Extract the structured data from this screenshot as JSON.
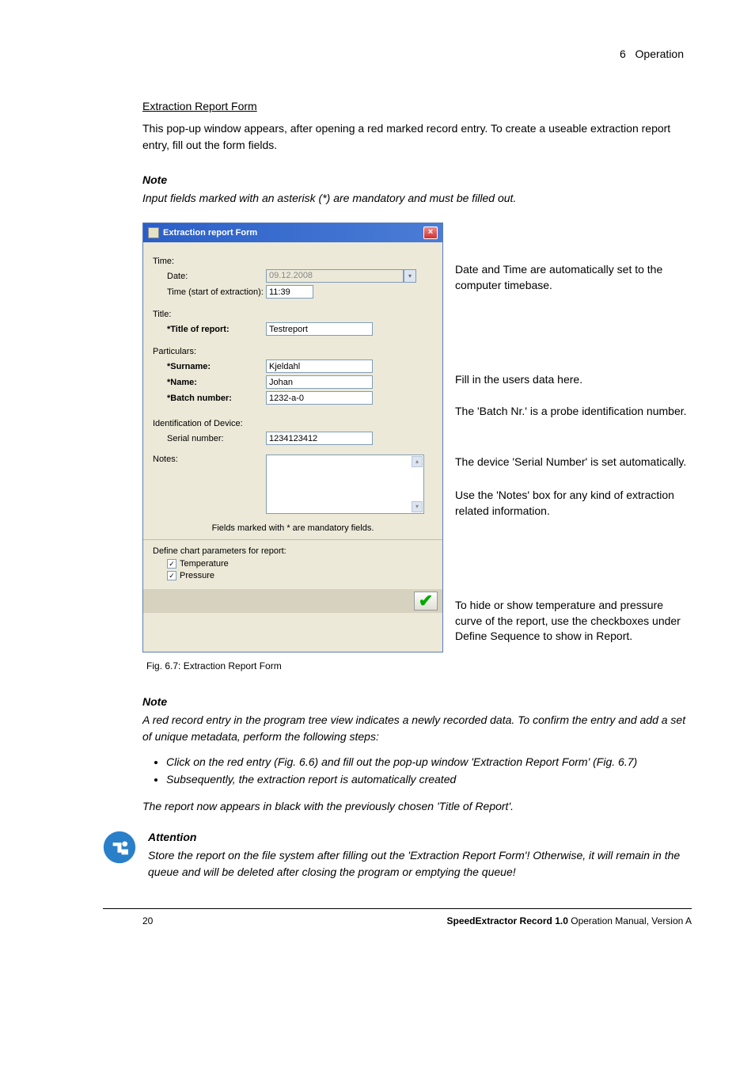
{
  "header": {
    "section_num": "6",
    "section_title": "Operation"
  },
  "section_heading": "Extraction Report Form",
  "intro_text": "This pop-up window appears, after opening a red marked record entry. To create a useable extraction report entry, fill out the form fields.",
  "note1": {
    "heading": "Note",
    "text": "Input fields marked with an asterisk (*) are mandatory and must be filled out."
  },
  "dialog": {
    "title": "Extraction report Form",
    "close": "×",
    "groups": {
      "time": "Time:",
      "title": "Title:",
      "particulars": "Particulars:",
      "identification": "Identification of Device:",
      "notes": "Notes:",
      "define_params": "Define chart parameters for report:"
    },
    "labels": {
      "date": "Date:",
      "time_start": "Time (start of extraction):",
      "title_report": "*Title of report:",
      "surname": "*Surname:",
      "name": "*Name:",
      "batch": "*Batch number:",
      "serial": "Serial number:",
      "temperature": "Temperature",
      "pressure": "Pressure"
    },
    "values": {
      "date": "09.12.2008",
      "time": "11:39",
      "title_report": "Testreport",
      "surname": "Kjeldahl",
      "name": "Johan",
      "batch": "1232-a-0",
      "serial": "1234123412"
    },
    "mandatory_hint": "Fields marked with * are mandatory fields.",
    "temperature_checked": true,
    "pressure_checked": true
  },
  "annotations": {
    "datetime": "Date and Time are automatically set to the computer timebase.",
    "users": "Fill in the users data here.",
    "batch": "The 'Batch Nr.' is a probe identification number.",
    "serial": "The device 'Serial Number' is set automatically.",
    "notes": "Use the 'Notes' box for any kind of extraction related information.",
    "checkboxes": "To hide or show temperature and pressure curve of the report, use the checkboxes under Define Sequence to show in Report."
  },
  "fig_caption": "Fig. 6.7: Extraction Report Form",
  "note2": {
    "heading": "Note",
    "text": "A red record entry in the program tree view indicates a newly recorded data. To confirm the entry and add a set of unique metadata, perform the following steps:",
    "bullets": [
      "Click on the red entry (Fig. 6.6) and fill out the pop-up window 'Extraction Report Form' (Fig. 6.7)",
      "Subsequently, the extraction report is automatically created"
    ],
    "after": "The report now appears in black with the previously chosen 'Title of Report'."
  },
  "attention": {
    "heading": "Attention",
    "text": "Store the report on the file system after filling out the 'Extraction Report Form'! Otherwise, it will remain in the queue and will be deleted after closing the program or emptying the queue!"
  },
  "footer": {
    "page": "20",
    "product": "SpeedExtractor Record 1.0",
    "rest": " Operation Manual, Version A"
  },
  "checkmark": "✓"
}
